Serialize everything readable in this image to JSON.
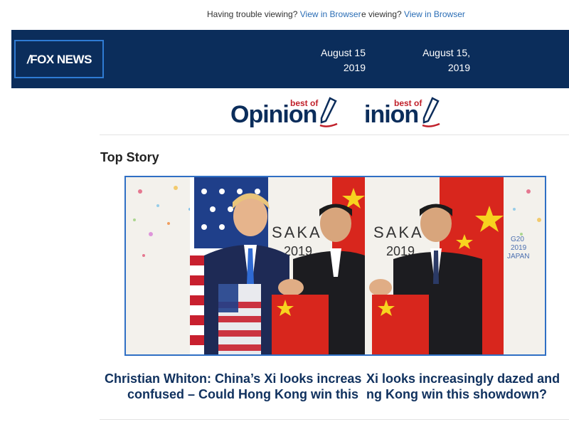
{
  "topbar": {
    "trouble_text_a": "Having trouble viewing? ",
    "view_link_a": "View in Browser",
    "trouble_text_b": "e viewing? ",
    "view_link_b": "View in Browser"
  },
  "header": {
    "logo_text": "FOX NEWS",
    "date_a_line1": "August 15",
    "date_a_line2": "2019",
    "date_b_line1": "August 15,",
    "date_b_line2": "2019"
  },
  "banner": {
    "best_of_a": "best of",
    "opinion_a": "Opinion",
    "best_of_b": "best of",
    "opinion_b": "inion"
  },
  "main": {
    "section_title": "Top Story",
    "headline_left_line1": "Christian Whiton: China’s Xi looks increas",
    "headline_left_line2": "confused – Could Hong Kong win this",
    "headline_right_line1": "Xi looks increasingly dazed and",
    "headline_right_line2": "ng Kong win this showdown?"
  },
  "colors": {
    "header_bg": "#0b2d5b",
    "link": "#2a6db5",
    "headline": "#10315e",
    "accent_red": "#c0202a",
    "frame_border": "#2f6fc4"
  }
}
